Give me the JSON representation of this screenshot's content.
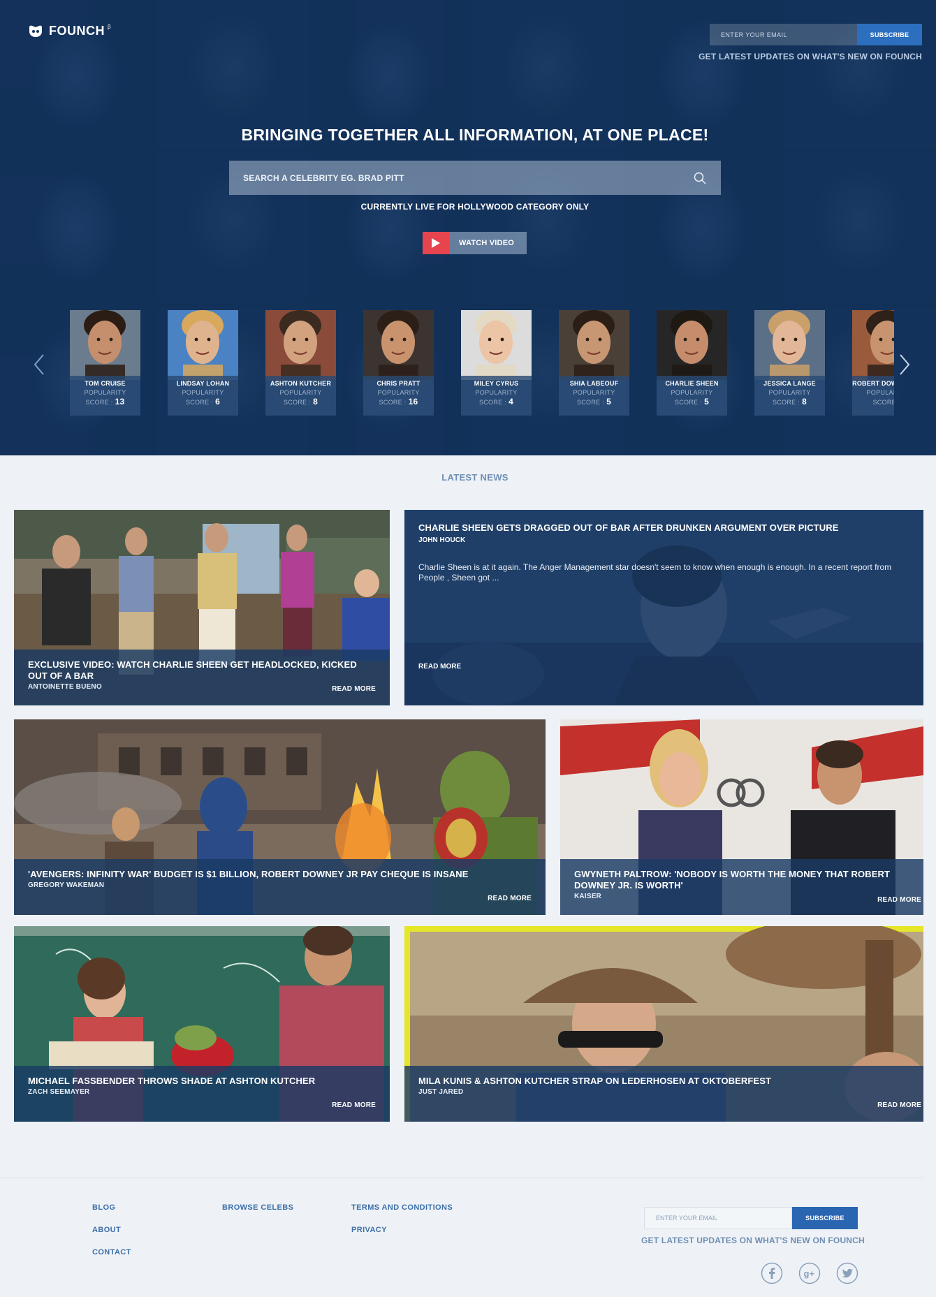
{
  "brand": {
    "name": "FOUNCH",
    "beta_mark": "β"
  },
  "header_subscribe": {
    "placeholder": "ENTER YOUR EMAIL",
    "button": "SUBSCRIBE",
    "tagline": "GET LATEST UPDATES ON WHAT'S NEW ON FOUNCH"
  },
  "hero": {
    "title": "BRINGING TOGETHER ALL INFORMATION, AT ONE PLACE!",
    "search_placeholder": "SEARCH A CELEBRITY EG. BRAD PITT",
    "note": "CURRENTLY LIVE FOR HOLLYWOOD CATEGORY ONLY",
    "watch_video": "WATCH VIDEO"
  },
  "celebs": [
    {
      "name": "TOM CRUISE",
      "popularity_label": "POPULARITY",
      "score_label": "SCORE :",
      "score": "13",
      "skin": "#c58f6e",
      "hair": "#2b1d14",
      "bg": "#6b7c8e"
    },
    {
      "name": "LINDSAY LOHAN",
      "popularity_label": "POPULARITY",
      "score_label": "SCORE :",
      "score": "6",
      "skin": "#e0b38f",
      "hair": "#d8a95c",
      "bg": "#4a82c3"
    },
    {
      "name": "ASHTON KUTCHER",
      "popularity_label": "POPULARITY",
      "score_label": "SCORE :",
      "score": "8",
      "skin": "#d2a17e",
      "hair": "#3a2a1f",
      "bg": "#8a4b3b"
    },
    {
      "name": "CHRIS PRATT",
      "popularity_label": "POPULARITY",
      "score_label": "SCORE :",
      "score": "16",
      "skin": "#c9936e",
      "hair": "#2b1f18",
      "bg": "#3c3430"
    },
    {
      "name": "MILEY CYRUS",
      "popularity_label": "POPULARITY",
      "score_label": "SCORE :",
      "score": "4",
      "skin": "#ecc4a6",
      "hair": "#e4d9c2",
      "bg": "#dcdcdc"
    },
    {
      "name": "SHIA LABEOUF",
      "popularity_label": "POPULARITY",
      "score_label": "SCORE :",
      "score": "5",
      "skin": "#c79672",
      "hair": "#2a1e16",
      "bg": "#4a4038"
    },
    {
      "name": "CHARLIE SHEEN",
      "popularity_label": "POPULARITY",
      "score_label": "SCORE :",
      "score": "5",
      "skin": "#c58d6c",
      "hair": "#1f1914",
      "bg": "#262626"
    },
    {
      "name": "JESSICA LANGE",
      "popularity_label": "POPULARITY",
      "score_label": "SCORE :",
      "score": "8",
      "skin": "#e2b797",
      "hair": "#caa06a",
      "bg": "#5b6f86"
    },
    {
      "name": "ROBERT DOWNEY JR.",
      "popularity_label": "POPULARITY",
      "score_label": "SCORE :",
      "score": "",
      "skin": "#c8946f",
      "hair": "#2d2119",
      "bg": "#9a5a3c"
    }
  ],
  "news_section": {
    "title": "LATEST NEWS"
  },
  "news": {
    "n1": {
      "title": "EXCLUSIVE VIDEO: WATCH CHARLIE SHEEN GET HEADLOCKED, KICKED OUT OF A BAR",
      "author": "ANTOINETTE BUENO",
      "read_more": "READ MORE"
    },
    "n2": {
      "title": "CHARLIE SHEEN GETS DRAGGED OUT OF BAR AFTER DRUNKEN ARGUMENT OVER PICTURE",
      "author": "JOHN HOUCK",
      "excerpt": "Charlie Sheen is at it again. The Anger Management star doesn't seem to know when enough is enough. In a recent report from People , Sheen got ...",
      "read_more": "READ MORE"
    },
    "n3": {
      "title": "'AVENGERS: INFINITY WAR' BUDGET IS $1 BILLION, ROBERT DOWNEY JR PAY CHEQUE IS INSANE",
      "author": "GREGORY WAKEMAN",
      "read_more": "READ MORE"
    },
    "n4": {
      "title": "GWYNETH PALTROW: 'NOBODY IS WORTH THE MONEY THAT ROBERT DOWNEY JR. IS WORTH'",
      "author": "KAISER",
      "read_more": "READ MORE"
    },
    "n5": {
      "title": "MICHAEL FASSBENDER THROWS SHADE AT ASHTON KUTCHER",
      "author": "ZACH SEEMAYER",
      "read_more": "READ MORE"
    },
    "n6": {
      "title": "MILA KUNIS & ASHTON KUTCHER STRAP ON LEDERHOSEN AT OKTOBERFEST",
      "author": "JUST JARED",
      "read_more": "READ MORE"
    }
  },
  "footer": {
    "col1": [
      "BLOG",
      "ABOUT",
      "CONTACT"
    ],
    "col2": [
      "BROWSE CELEBS"
    ],
    "col3": [
      "TERMS AND CONDITIONS",
      "PRIVACY"
    ],
    "subscribe_placeholder": "ENTER YOUR EMAIL",
    "subscribe_button": "SUBSCRIBE",
    "tagline": "GET LATEST UPDATES ON WHAT'S NEW ON FOUNCH",
    "social": [
      "facebook-icon",
      "google-plus-icon",
      "twitter-icon"
    ]
  },
  "colors": {
    "accent": "#2d6fbf",
    "play": "#e6444e",
    "hero": "#16335a",
    "link": "#3d6fa8"
  }
}
